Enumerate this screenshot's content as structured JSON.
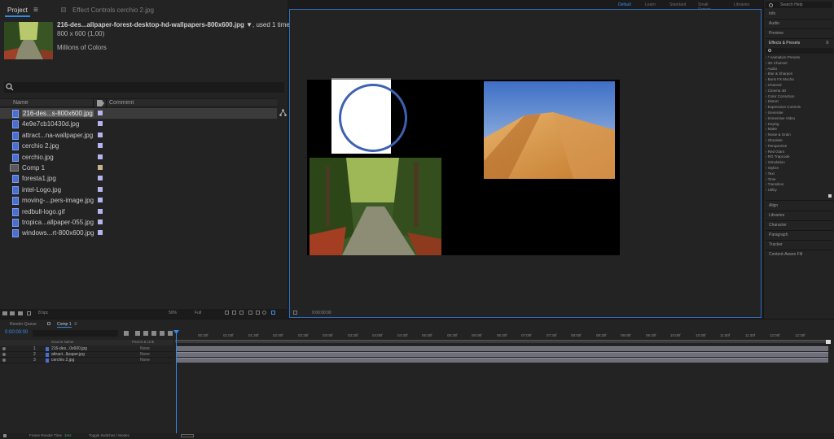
{
  "project_panel": {
    "tab_project": "Project",
    "tab_effect_controls": "Effect Controls cerchio 2.jpg",
    "selected_file": {
      "title": "216-des...allpaper-forest-desktop-hd-wallpapers-800x600.jpg ▼",
      "used": ", used 1 time",
      "dims": "800 x 600 (1,00)",
      "colors": "Millions of Colors"
    },
    "search_placeholder": "",
    "columns": {
      "name": "Name",
      "comment": "Comment"
    },
    "items": [
      {
        "name": "216-des...s-800x600.jpg",
        "type": "file",
        "selected": true
      },
      {
        "name": "4e9e7cb10430d.jpg",
        "type": "file"
      },
      {
        "name": "attract...na-wallpaper.jpg",
        "type": "file"
      },
      {
        "name": "cerchio 2.jpg",
        "type": "file"
      },
      {
        "name": "cerchio.jpg",
        "type": "file"
      },
      {
        "name": "Comp 1",
        "type": "comp"
      },
      {
        "name": "foresta1.jpg",
        "type": "file"
      },
      {
        "name": "intel-Logo.jpg",
        "type": "file"
      },
      {
        "name": "moving-...pers-image.jpg",
        "type": "file"
      },
      {
        "name": "redbull-logo.gif",
        "type": "file"
      },
      {
        "name": "tropica...allpaper-055.jpg",
        "type": "file"
      },
      {
        "name": "windows...rt-800x600.jpg",
        "type": "file"
      }
    ],
    "footer_bpc": "8 bpc"
  },
  "viewer": {
    "zoom": "50%",
    "resolution": "Full",
    "timecode": "0:00:00:00"
  },
  "workspaces": [
    "Default",
    "Learn",
    "Standard",
    "Small Screen",
    "Libraries"
  ],
  "right_panel": {
    "search_help": "Search Help",
    "panels_top": [
      "Info",
      "Audio",
      "Preview",
      "Effects & Presets"
    ],
    "effects": [
      "› * Animation Presets",
      "› 3D Channel",
      "› Audio",
      "› Blur & Sharpen",
      "› Boris FX Mocha",
      "› Channel",
      "› Cinema 4D",
      "› Color Correction",
      "› Distort",
      "› Expression Controls",
      "› Generate",
      "› Immersive Video",
      "› Keying",
      "› Matte",
      "› Noise & Grain",
      "› Obsolete",
      "› Perspective",
      "› Red Giant",
      "› RG Trapcode",
      "› Simulation",
      "› Stylize",
      "› Text",
      "› Time",
      "› Transition",
      "› Utility"
    ],
    "panels_bottom": [
      "Align",
      "Libraries",
      "Character",
      "Paragraph",
      "Tracker",
      "Content-Aware Fill"
    ]
  },
  "timeline": {
    "tab_render_queue": "Render Queue",
    "tab_comp": "Comp 1",
    "current_time": "0:00:00:00",
    "header": {
      "source_name": "Source Name",
      "parent": "Parent & Link"
    },
    "layers": [
      {
        "num": "1",
        "name": "216-des...0x600.jpg",
        "parent": "None"
      },
      {
        "num": "2",
        "name": "attract...llpaper.jpg",
        "parent": "None"
      },
      {
        "num": "3",
        "name": "cerchio 2.jpg",
        "parent": "None"
      }
    ],
    "ticks": [
      "00:30f",
      "01:00f",
      "01:30f",
      "02:00f",
      "02:30f",
      "03:00f",
      "03:30f",
      "04:00f",
      "04:30f",
      "05:00f",
      "05:30f",
      "06:00f",
      "06:30f",
      "07:00f",
      "07:30f",
      "08:00f",
      "08:30f",
      "09:00f",
      "09:30f",
      "10:00f",
      "10:30f",
      "11:00f",
      "11:30f",
      "12:00f",
      "12:30f"
    ],
    "footer_left": "Frame Render Time",
    "footer_value": "1ms",
    "footer_toggle": "Toggle Switches / Modes"
  },
  "colors": {
    "accent": "#2d8ceb",
    "bg": "#232323",
    "label_file": "#b4b4ee",
    "label_comp": "#c8b48a",
    "circle": "#3d62b2"
  }
}
